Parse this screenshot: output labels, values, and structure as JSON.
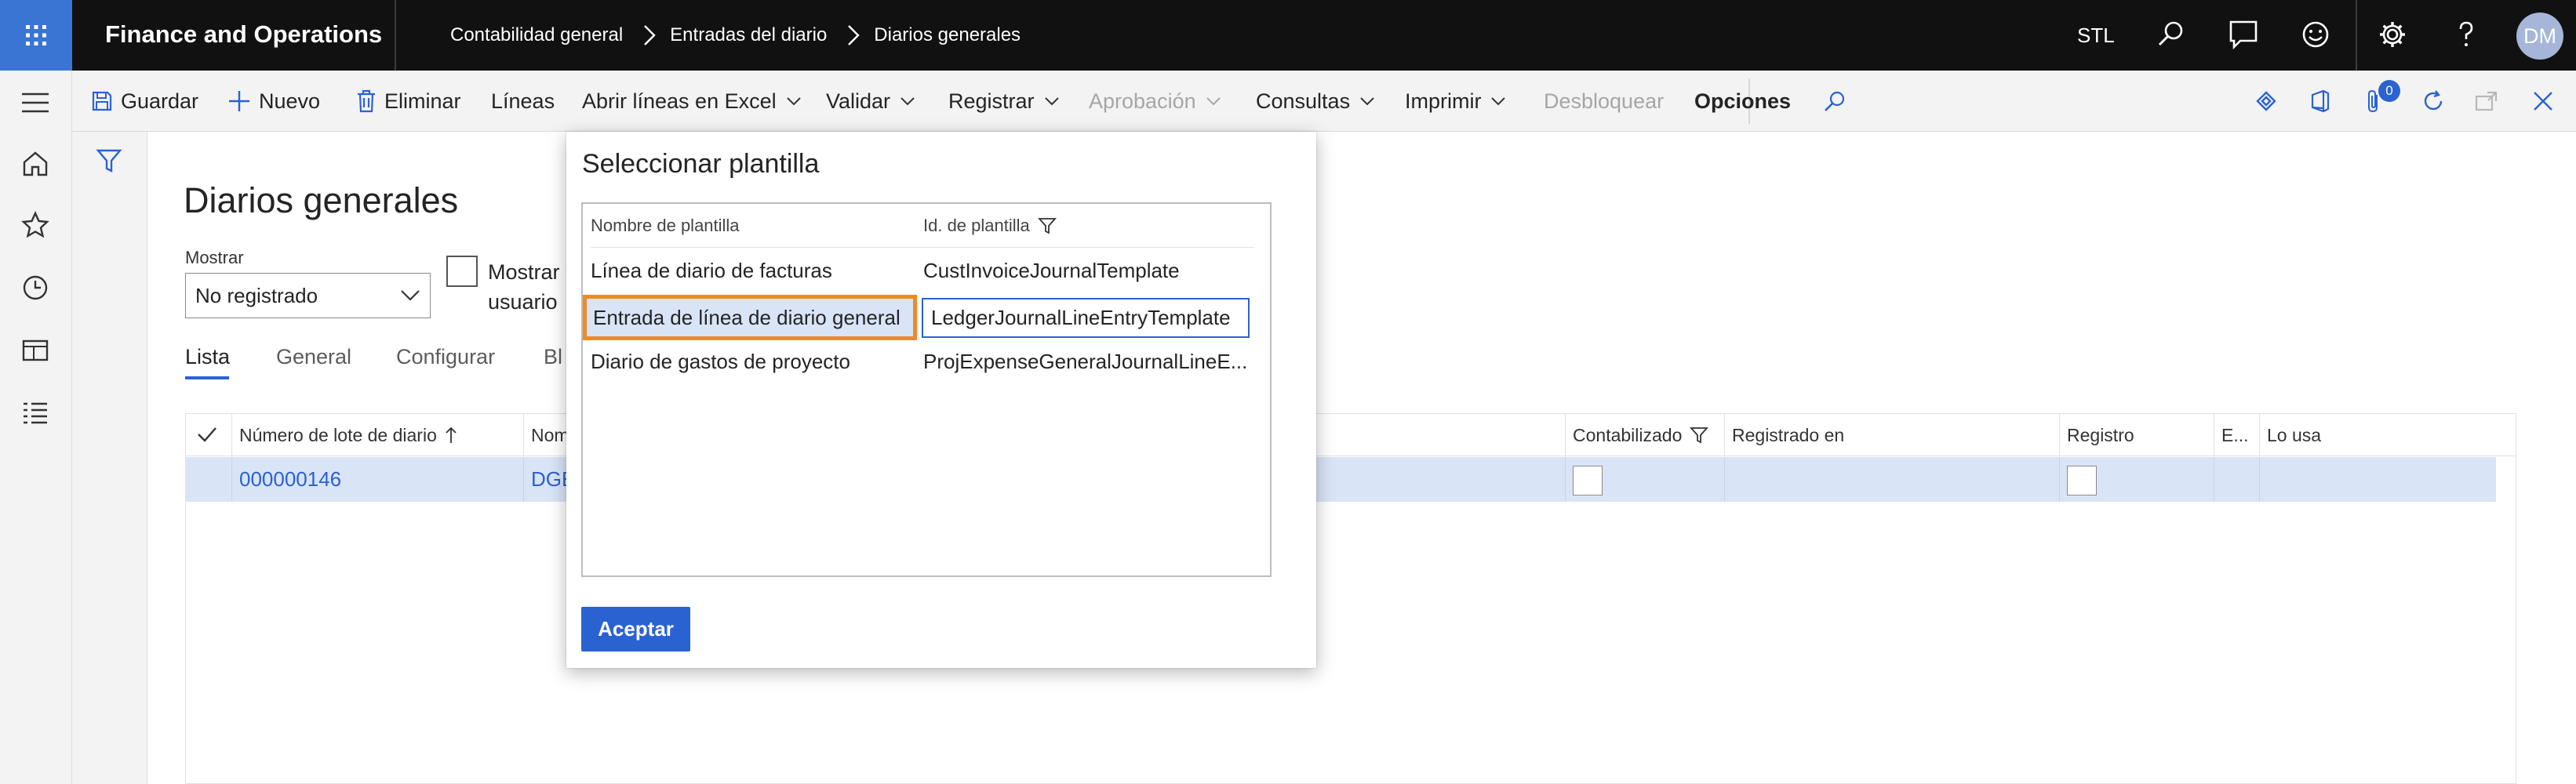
{
  "topbar": {
    "app_name": "Finance and Operations",
    "breadcrumbs": [
      "Contabilidad general",
      "Entradas del diario",
      "Diarios generales"
    ],
    "company": "STL",
    "user_initials": "DM",
    "icons": [
      "waffle-icon",
      "search-icon",
      "chat-icon",
      "smiley-icon",
      "gear-icon",
      "help-icon"
    ]
  },
  "actionpane": {
    "save": "Guardar",
    "new": "Nuevo",
    "delete": "Eliminar",
    "lines": "Líneas",
    "excel": "Abrir líneas en Excel",
    "validate": "Validar",
    "post": "Registrar",
    "approval": "Aprobación",
    "inquiries": "Consultas",
    "print": "Imprimir",
    "unlock": "Desbloquear",
    "options": "Opciones",
    "attachments_count": "0"
  },
  "page": {
    "title": "Diarios generales",
    "show_label": "Mostrar",
    "show_value": "No registrado",
    "user_filter_line1": "Mostrar",
    "user_filter_line2": "usuario",
    "tabs": [
      "Lista",
      "General",
      "Configurar",
      "Bl"
    ]
  },
  "grid": {
    "columns": {
      "batch": "Número de lote de diario",
      "name": "Nom",
      "posted": "Contabilizado",
      "posted_on": "Registrado en",
      "log": "Registro",
      "e": "E...",
      "in_use": "Lo usa"
    },
    "row": {
      "batch": "000000146",
      "name": "DGE"
    }
  },
  "dialog": {
    "title": "Seleccionar plantilla",
    "col_name": "Nombre de plantilla",
    "col_id": "Id. de plantilla",
    "rows": [
      {
        "name": "Línea de diario de facturas",
        "id": "CustInvoiceJournalTemplate"
      },
      {
        "name": "Entrada de línea de diario general",
        "id": "LedgerJournalLineEntryTemplate"
      },
      {
        "name": "Diario de gastos de proyecto",
        "id": "ProjExpenseGeneralJournalLineE..."
      }
    ],
    "accept": "Aceptar"
  }
}
